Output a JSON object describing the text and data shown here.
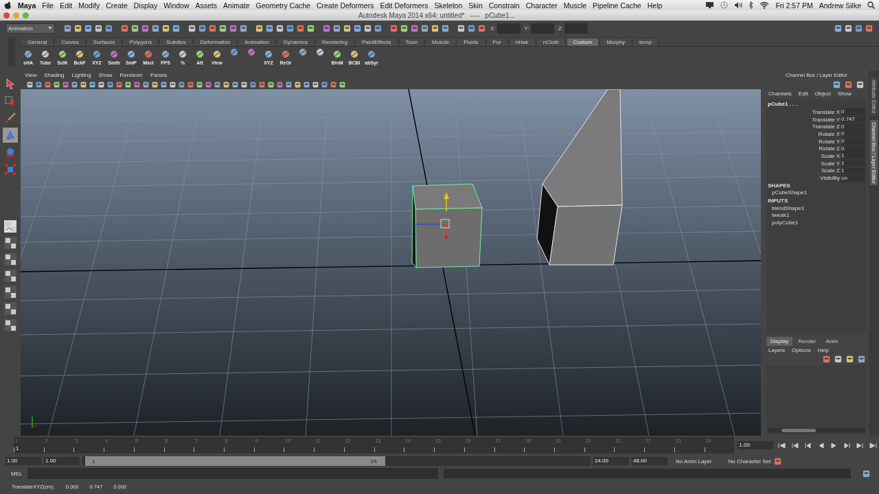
{
  "menubar": {
    "app": "Maya",
    "menus": [
      "File",
      "Edit",
      "Modify",
      "Create",
      "Display",
      "Window",
      "Assets",
      "Animate",
      "Geometry Cache",
      "Create Deformers",
      "Edit Deformers",
      "Skeleton",
      "Skin",
      "Constrain",
      "Character",
      "Muscle",
      "Pipeline Cache",
      "Help"
    ],
    "clock": "Fri 2:57 PM",
    "user": "Andrew Silke"
  },
  "window": {
    "title": "Autodesk Maya 2014 x64: untitled*   ----   pCube1..."
  },
  "status_line": {
    "mode": "Animation",
    "coords": [
      "X:",
      "Y:",
      "Z:"
    ]
  },
  "shelf": {
    "tabs": [
      {
        "label": "General",
        "selected": false
      },
      {
        "label": "Curves",
        "selected": false
      },
      {
        "label": "Surfaces",
        "selected": false
      },
      {
        "label": "Polygons",
        "selected": false
      },
      {
        "label": "Subdivs",
        "selected": false
      },
      {
        "label": "Deformation",
        "selected": false
      },
      {
        "label": "Animation",
        "selected": false
      },
      {
        "label": "Dynamics",
        "selected": false
      },
      {
        "label": "Rendering",
        "selected": false
      },
      {
        "label": "PaintEffects",
        "selected": false
      },
      {
        "label": "Toon",
        "selected": false
      },
      {
        "label": "Muscle",
        "selected": false
      },
      {
        "label": "Fluids",
        "selected": false
      },
      {
        "label": "Fur",
        "selected": false
      },
      {
        "label": "nHair",
        "selected": false
      },
      {
        "label": "nCloth",
        "selected": false
      },
      {
        "label": "Custom",
        "selected": true
      },
      {
        "label": "Morphy",
        "selected": false
      },
      {
        "label": "temp",
        "selected": false
      }
    ],
    "items": [
      {
        "kind": "labeled",
        "label": "sHA"
      },
      {
        "kind": "labeled",
        "label": "Tube"
      },
      {
        "kind": "labeled",
        "label": "SclK"
      },
      {
        "kind": "labeled",
        "label": "BckF"
      },
      {
        "kind": "labeled",
        "label": "XYZ"
      },
      {
        "kind": "labeled",
        "label": "Smth"
      },
      {
        "kind": "labeled",
        "label": "SmP"
      },
      {
        "kind": "labeled",
        "label": "Mscl"
      },
      {
        "kind": "labeled",
        "label": "FPS"
      },
      {
        "kind": "labeled",
        "label": "%"
      },
      {
        "kind": "labeled",
        "label": "Att"
      },
      {
        "kind": "labeled",
        "label": "View"
      },
      {
        "kind": "icon"
      },
      {
        "kind": "icon"
      },
      {
        "kind": "labeled",
        "label": "XYZ"
      },
      {
        "kind": "labeled",
        "label": "ReOr"
      },
      {
        "kind": "icon"
      },
      {
        "kind": "icon"
      },
      {
        "kind": "labeled",
        "label": "BlnM"
      },
      {
        "kind": "labeled",
        "label": "BCBl"
      },
      {
        "kind": "labeled",
        "label": "abSyr"
      }
    ]
  },
  "toolbox": [
    {
      "kind": "select",
      "selected": false
    },
    {
      "kind": "lasso",
      "selected": false
    },
    {
      "kind": "paint",
      "selected": false
    },
    {
      "kind": "move",
      "selected": true
    },
    {
      "kind": "rotate",
      "selected": false
    },
    {
      "kind": "scale",
      "selected": false
    }
  ],
  "viewport": {
    "menus": [
      "View",
      "Shading",
      "Lighting",
      "Show",
      "Renderer",
      "Panels"
    ],
    "objects": [
      {
        "kind": "cube",
        "selected": true
      },
      {
        "kind": "box",
        "selected": false
      }
    ]
  },
  "channel_box": {
    "title": "Channel Box / Layer Editor",
    "menus": [
      "Channels",
      "Edit",
      "Object",
      "Show"
    ],
    "object": "pCube1 . . .",
    "channels": [
      {
        "name": "Translate X",
        "value": "0"
      },
      {
        "name": "Translate Y",
        "value": "0.747"
      },
      {
        "name": "Translate Z",
        "value": "0"
      },
      {
        "name": "Rotate X",
        "value": "0"
      },
      {
        "name": "Rotate Y",
        "value": "0"
      },
      {
        "name": "Rotate Z",
        "value": "0"
      },
      {
        "name": "Scale X",
        "value": "1"
      },
      {
        "name": "Scale Y",
        "value": "1"
      },
      {
        "name": "Scale Z",
        "value": "1"
      },
      {
        "name": "Visibility",
        "value": "on"
      }
    ],
    "sections": [
      {
        "heading": "SHAPES",
        "items": [
          "pCubeShape1"
        ]
      },
      {
        "heading": "INPUTS",
        "items": [
          "blendShape1",
          "tweak1",
          "polyCube1"
        ]
      }
    ]
  },
  "layer_editor": {
    "tabs": [
      {
        "label": "Display",
        "selected": true
      },
      {
        "label": "Render",
        "selected": false
      },
      {
        "label": "Anim",
        "selected": false
      }
    ],
    "menus": [
      "Layers",
      "Options",
      "Help"
    ]
  },
  "side_tabs": [
    {
      "label": "Attribute Editor",
      "selected": false
    },
    {
      "label": "Channel Box / Layer Editor",
      "selected": true
    }
  ],
  "time_slider": {
    "ticks": [
      "1",
      "2",
      "3",
      "4",
      "5",
      "6",
      "7",
      "8",
      "9",
      "10",
      "11",
      "12",
      "13",
      "14",
      "15",
      "16",
      "17",
      "18",
      "19",
      "20",
      "21",
      "22",
      "23",
      "24"
    ],
    "current_frame": "1",
    "current_time": "1.00",
    "level": 0
  },
  "range_slider": {
    "start": "1.00",
    "range_start": "1.00",
    "range_min": "1",
    "range_max": "24",
    "level": 0.59,
    "range_end": "24.00",
    "end": "48.00",
    "anim_layer": "No Anim Layer",
    "character_set": "No Character Set"
  },
  "command_line": {
    "language": "MEL"
  },
  "help_line": {
    "label": "TranslateXYZ(cm):",
    "values": [
      "0.000",
      "0.747",
      "0.000"
    ]
  }
}
